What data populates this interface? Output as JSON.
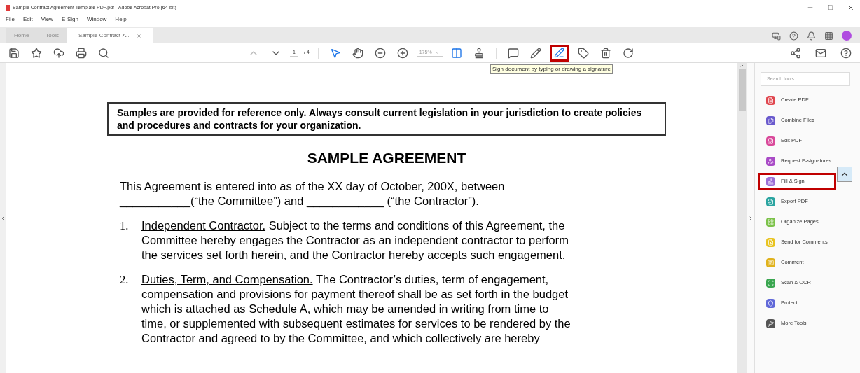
{
  "window": {
    "title": "Sample Contract Agreement Template PDF.pdf - Adobe Acrobat Pro (64-bit)"
  },
  "menu": [
    "File",
    "Edit",
    "View",
    "E-Sign",
    "Window",
    "Help"
  ],
  "tabs": [
    {
      "label": "Home",
      "kind": "nav",
      "selected": false
    },
    {
      "label": "Tools",
      "kind": "nav",
      "selected": false
    },
    {
      "label": "Sample-Contract-A...",
      "kind": "doc",
      "selected": true
    }
  ],
  "toolbar": {
    "page": "1",
    "pages": "/ 4",
    "zoom": "175%",
    "sign_selected": true,
    "tooltip": "Sign document by typing or drawing a signature"
  },
  "search": {
    "placeholder": "Search tools"
  },
  "tools": [
    {
      "label": "Create PDF",
      "color": "#e0464e",
      "selected": false
    },
    {
      "label": "Combine Files",
      "color": "#6a5acd",
      "selected": false
    },
    {
      "label": "Edit PDF",
      "color": "#d9499a",
      "selected": false
    },
    {
      "label": "Request E-signatures",
      "color": "#a94bc6",
      "selected": false
    },
    {
      "label": "Fill & Sign",
      "color": "#9b6fd6",
      "selected": true
    },
    {
      "label": "Export PDF",
      "color": "#2aa4a0",
      "selected": false
    },
    {
      "label": "Organize Pages",
      "color": "#7cc24a",
      "selected": false
    },
    {
      "label": "Send for Comments",
      "color": "#e8c31f",
      "selected": false
    },
    {
      "label": "Comment",
      "color": "#e0b21c",
      "selected": false
    },
    {
      "label": "Scan & OCR",
      "color": "#3aa650",
      "selected": false
    },
    {
      "label": "Protect",
      "color": "#6068d8",
      "selected": false
    },
    {
      "label": "More Tools",
      "color": "#555555",
      "selected": false
    }
  ],
  "document": {
    "notice": "Samples are provided for reference only.  Always consult current legislation in your jurisdiction to create policies and procedures and contracts for your organization.",
    "title": "SAMPLE AGREEMENT",
    "intro": [
      "This Agreement is entered into as of the XX day of October, 200X, between",
      "___________(“the Committee”) and ____________ (“the Contractor”)."
    ],
    "items": [
      {
        "number": "1.",
        "heading": "Independent Contractor.",
        "lines": [
          "Subject to the terms and conditions of this Agreement, the",
          "Committee hereby engages the Contractor as an independent contractor to perform",
          "the services set forth herein, and the Contractor hereby accepts such engagement."
        ]
      },
      {
        "number": "2.",
        "heading": "Duties, Term, and Compensation.",
        "lines": [
          "The Contractor’s duties, term of engagement,",
          "compensation and provisions for payment thereof shall be as set forth in the budget",
          "which is attached as Schedule A, which may be amended in writing from time to",
          "time, or supplemented with subsequent estimates for services to be rendered by the",
          "Contractor and agreed to by the Committee, and which collectively are hereby"
        ]
      }
    ]
  }
}
